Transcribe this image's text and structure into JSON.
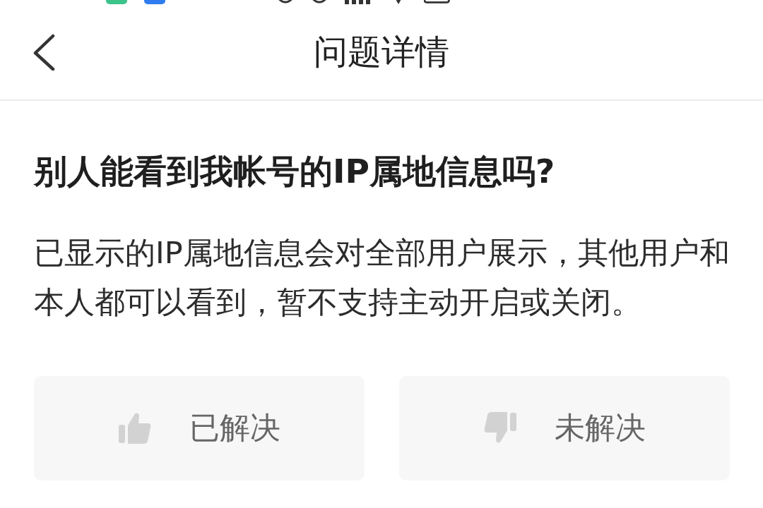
{
  "nav": {
    "title": "问题详情"
  },
  "question": {
    "title": "别人能看到我帐号的IP属地信息吗?",
    "answer": "已显示的IP属地信息会对全部用户展示，其他用户和本人都可以看到，暂不支持主动开启或关闭。"
  },
  "feedback": [
    {
      "kind": "solved",
      "label": "已解决"
    },
    {
      "kind": "unsolved",
      "label": "未解决"
    }
  ]
}
